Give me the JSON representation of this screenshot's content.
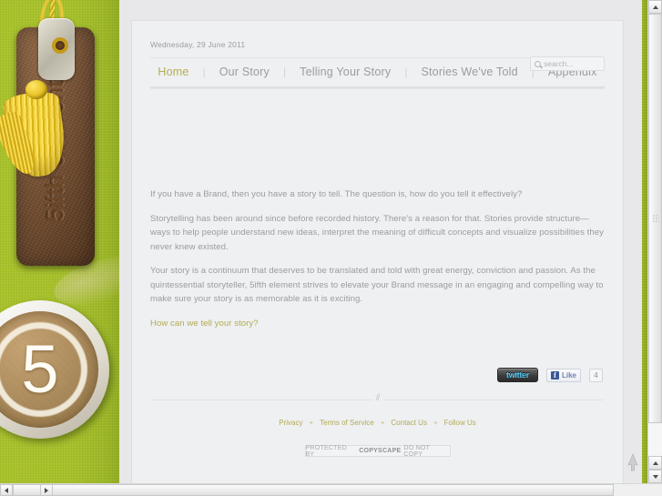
{
  "brand": {
    "tag_text": "5ifth element",
    "cup_numeral": "5",
    "eyelet_icon": "eyelet-icon",
    "tassel_icon": "tassel-icon"
  },
  "header": {
    "date": "Wednesday, 29 June 2011"
  },
  "search": {
    "placeholder": "search...",
    "value": "",
    "icon": "search-icon"
  },
  "nav": {
    "items": [
      {
        "label": "Home",
        "active": true
      },
      {
        "label": "Our Story",
        "active": false
      },
      {
        "label": "Telling Your Story",
        "active": false
      },
      {
        "label": "Stories We've Told",
        "active": false
      },
      {
        "label": "Appendix",
        "active": false
      }
    ],
    "separator": "|"
  },
  "main": {
    "paragraphs": [
      "If you have a Brand, then you have a story to tell. The question is, how do you tell it effectively?",
      "Storytelling has been around since before recorded history. There's a reason for that. Stories provide structure—ways to help people understand new ideas, interpret the meaning of difficult concepts and visualize possibilities they never knew existed.",
      "Your story is a continuum that deserves to be translated and told with great energy, conviction and passion. As the quintessential storyteller, 5ifth element strives to elevate your Brand message in an engaging and compelling way to make sure your story is as memorable as it is exciting."
    ],
    "cta_link": "How can we tell your story?"
  },
  "social": {
    "twitter_label": "twitter",
    "facebook_icon": "facebook-icon",
    "facebook_like_label": "Like",
    "facebook_like_count": "4"
  },
  "footer": {
    "divider_mark": "//",
    "links": [
      "Privacy",
      "Terms of Service",
      "Contact Us",
      "Follow Us"
    ],
    "link_separator": "+",
    "copyscape": {
      "prefix": "PROTECTED BY",
      "brand": "COPYSCAPE",
      "suffix": "DO NOT COPY"
    }
  },
  "colors": {
    "accent_olive": "#b7ad55",
    "green_panel": "#a6c029",
    "leather": "#7a4f2c",
    "gold_tassel": "#e7c221",
    "body_text": "#9a9c9e",
    "sheet_bg": "#eef0f1"
  },
  "scrollbars": {
    "vertical_up_icon": "scroll-up-arrow-icon",
    "vertical_down_icon": "scroll-down-arrow-icon",
    "horizontal_left_icon": "scroll-left-arrow-icon",
    "horizontal_right_icon": "scroll-right-arrow-icon"
  }
}
